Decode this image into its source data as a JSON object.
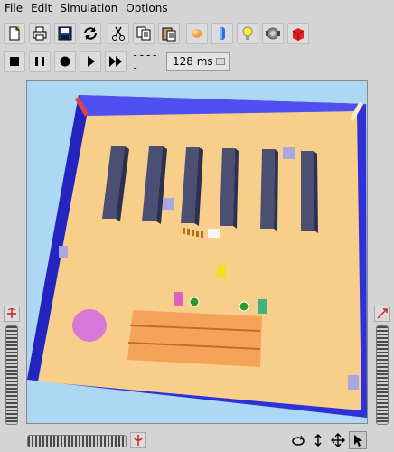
{
  "menubar": {
    "items": [
      "File",
      "Edit",
      "Simulation",
      "Options"
    ]
  },
  "toolbar": {
    "buttons": [
      "new-icon",
      "print-icon",
      "save-icon",
      "refresh-icon",
      "cut-icon",
      "copy-icon",
      "paste-icon",
      "sphere-icon",
      "cylinder-icon",
      "light-icon",
      "robot-icon",
      "box-icon"
    ]
  },
  "sim": {
    "buttons": [
      "stop-icon",
      "pause-icon",
      "record-icon",
      "play-icon",
      "fast-forward-icon"
    ],
    "time_display": "-----",
    "speed": "128 ms"
  },
  "colors": {
    "floor": "#f7cf8a",
    "wall": "#3333e0",
    "sky": "#add8f4",
    "pillar": "#4a4f73",
    "ramp": "#f5a25a",
    "disc": "#d778d7"
  }
}
